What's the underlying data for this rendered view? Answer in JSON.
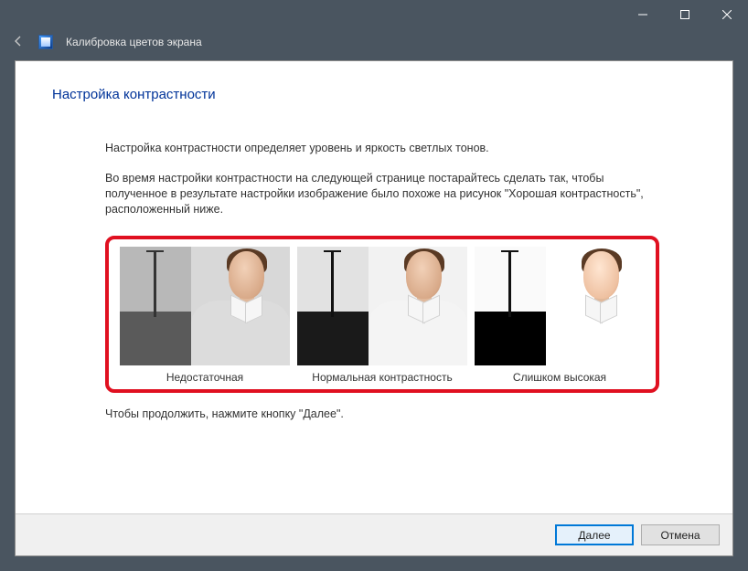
{
  "window": {
    "app_title": "Калибровка цветов экрана"
  },
  "page": {
    "title": "Настройка контрастности",
    "para1": "Настройка контрастности определяет уровень и яркость светлых тонов.",
    "para2": "Во время настройки контрастности на следующей странице постарайтесь сделать так, чтобы полученное в результате настройки изображение было похоже на рисунок \"Хорошая контрастность\", расположенный ниже.",
    "continue": "Чтобы продолжить, нажмите кнопку \"Далее\"."
  },
  "samples": {
    "low": "Недостаточная",
    "normal": "Нормальная контрастность",
    "high": "Слишком высокая"
  },
  "buttons": {
    "next": "Далее",
    "cancel": "Отмена"
  }
}
